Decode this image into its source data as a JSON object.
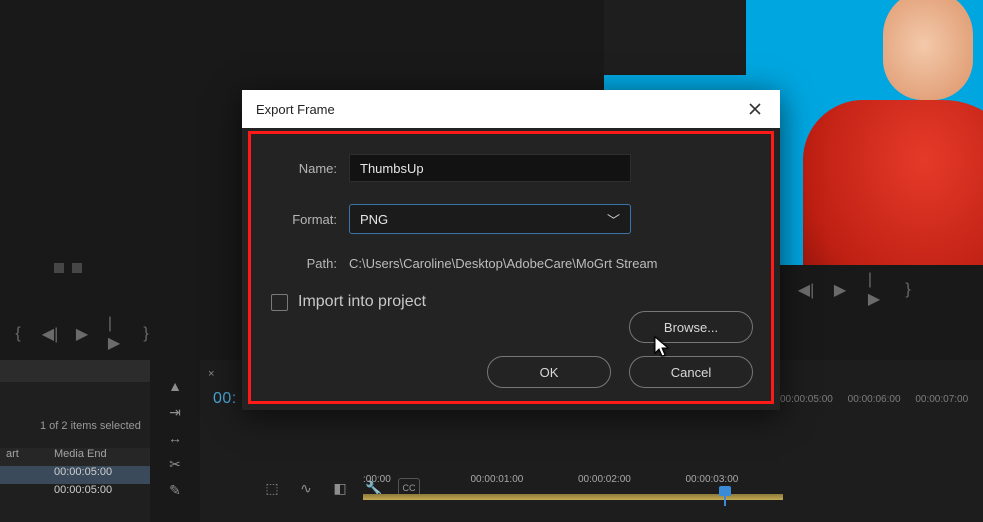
{
  "preview": {},
  "project": {
    "header_a": "",
    "header_b": "",
    "selected_text": "1 of 2 items selected",
    "col_a": "art",
    "col_b": "Media End",
    "rows": [
      {
        "a": "",
        "b": "00:00:05:00"
      },
      {
        "a": "",
        "b": "00:00:05:00"
      }
    ]
  },
  "timeline": {
    "tab": "",
    "playhead_time": "00:",
    "ruler_top": [
      "00:00:05:00",
      "00:00:06:00",
      "00:00:07:00"
    ],
    "ruler_bottom": [
      ":00:00",
      "00:00:01:00",
      "00:00:02:00",
      "00:00:03:00"
    ],
    "cc_label": "CC"
  },
  "dialog": {
    "title": "Export Frame",
    "name_label": "Name:",
    "name_value": "ThumbsUp",
    "format_label": "Format:",
    "format_value": "PNG",
    "path_label": "Path:",
    "path_value": "C:\\Users\\Caroline\\Desktop\\AdobeCare\\MoGrt Stream",
    "import_label": "Import into project",
    "browse": "Browse...",
    "ok": "OK",
    "cancel": "Cancel"
  }
}
